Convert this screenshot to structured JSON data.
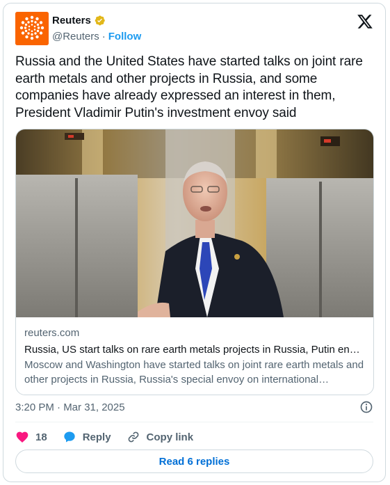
{
  "author": {
    "name": "Reuters",
    "handle": "@Reuters",
    "separator": "·",
    "follow_label": "Follow",
    "verified": true,
    "avatar_color": "#fa6400"
  },
  "tweet": {
    "text": "Russia and the United States have started talks on joint rare earth metals and other projects in Russia, and some companies have already expressed an interest in them, President Vladimir Putin's investment envoy said"
  },
  "link_card": {
    "domain": "reuters.com",
    "title": "Russia, US start talks on rare earth metals projects in Russia, Putin envoy says",
    "description": "Moscow and Washington have started talks on joint rare earth metals and other projects in Russia, Russia's special envoy on international economic cooperation said"
  },
  "meta": {
    "timestamp": "3:20 PM · Mar 31, 2025"
  },
  "actions": {
    "like_count": "18",
    "reply_label": "Reply",
    "copy_label": "Copy link"
  },
  "read_replies_label": "Read 6 replies",
  "icons": {
    "like": "heart-icon",
    "reply": "speech-bubble-icon",
    "copy": "link-icon",
    "info": "info-icon",
    "brand": "x-logo-icon",
    "verified": "verified-badge-icon"
  },
  "colors": {
    "accent": "#1d9bf0",
    "like": "#f91880",
    "verified": "#e2b719",
    "text": "#0f1419",
    "muted": "#536471"
  }
}
